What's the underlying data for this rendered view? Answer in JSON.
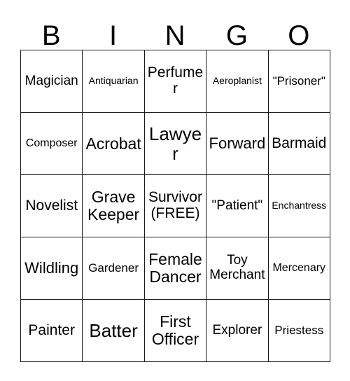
{
  "card": {
    "header_letters": [
      "B",
      "I",
      "N",
      "G",
      "O"
    ],
    "rows": [
      [
        {
          "text": "Magician",
          "size": "fs-lg"
        },
        {
          "text": "Antiquarian",
          "size": "fs-xs"
        },
        {
          "text": "Perfumer",
          "size": "fs-xl"
        },
        {
          "text": "Aeroplanist",
          "size": "fs-xs"
        },
        {
          "text": "\"Prisoner\"",
          "size": "fs-md"
        }
      ],
      [
        {
          "text": "Composer",
          "size": "fs-sm"
        },
        {
          "text": "Acrobat",
          "size": "fs-3xl"
        },
        {
          "text": "Lawyer",
          "size": "fs-4xl"
        },
        {
          "text": "Forward",
          "size": "fs-2xl"
        },
        {
          "text": "Barmaid",
          "size": "fs-xl"
        }
      ],
      [
        {
          "text": "Novelist",
          "size": "fs-xl"
        },
        {
          "text": "Grave Keeper",
          "size": "fs-3xl"
        },
        {
          "text": "Survivor (FREE)",
          "size": "fs-xl"
        },
        {
          "text": "\"Patient\"",
          "size": "fs-lg"
        },
        {
          "text": "Enchantress",
          "size": "fs-xs"
        }
      ],
      [
        {
          "text": "Wildling",
          "size": "fs-2xl"
        },
        {
          "text": "Gardener",
          "size": "fs-md"
        },
        {
          "text": "Female Dancer",
          "size": "fs-3xl"
        },
        {
          "text": "Toy Merchant",
          "size": "fs-lg"
        },
        {
          "text": "Mercenary",
          "size": "fs-sm"
        }
      ],
      [
        {
          "text": "Painter",
          "size": "fs-xl"
        },
        {
          "text": "Batter",
          "size": "fs-4xl"
        },
        {
          "text": "First Officer",
          "size": "fs-3xl"
        },
        {
          "text": "Explorer",
          "size": "fs-lg"
        },
        {
          "text": "Priestess",
          "size": "fs-md"
        }
      ]
    ]
  }
}
